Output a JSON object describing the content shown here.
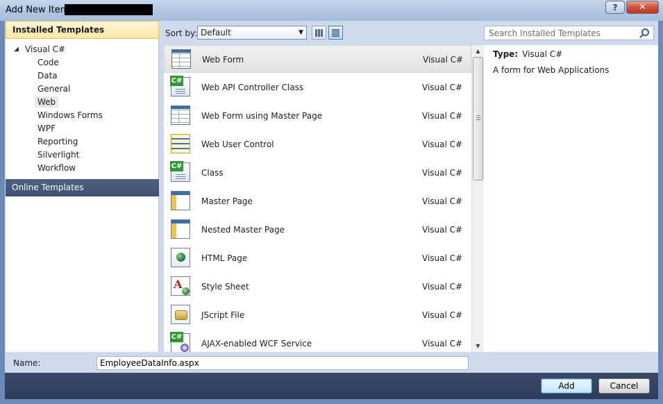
{
  "window": {
    "title": "Add New Item - ",
    "help_label": "?",
    "close_label": "✕"
  },
  "left": {
    "installed_header": "Installed Templates",
    "root": "Visual C#",
    "items": [
      "Code",
      "Data",
      "General",
      "Web",
      "Windows Forms",
      "WPF",
      "Reporting",
      "Silverlight",
      "Workflow"
    ],
    "selected": "Web",
    "online_header": "Online Templates"
  },
  "toolbar": {
    "sort_label": "Sort by:",
    "sort_value": "Default"
  },
  "search": {
    "placeholder": "Search Installed Templates"
  },
  "templates": [
    {
      "name": "Web Form",
      "lang": "Visual C#",
      "icon": "web-form-icon"
    },
    {
      "name": "Web API Controller Class",
      "lang": "Visual C#",
      "icon": "csharp-class-icon"
    },
    {
      "name": "Web Form using Master Page",
      "lang": "Visual C#",
      "icon": "web-form-icon"
    },
    {
      "name": "Web User Control",
      "lang": "Visual C#",
      "icon": "user-control-icon"
    },
    {
      "name": "Class",
      "lang": "Visual C#",
      "icon": "csharp-class-icon"
    },
    {
      "name": "Master Page",
      "lang": "Visual C#",
      "icon": "master-page-icon"
    },
    {
      "name": "Nested Master Page",
      "lang": "Visual C#",
      "icon": "master-page-icon"
    },
    {
      "name": "HTML Page",
      "lang": "Visual C#",
      "icon": "html-page-icon"
    },
    {
      "name": "Style Sheet",
      "lang": "Visual C#",
      "icon": "style-sheet-icon"
    },
    {
      "name": "JScript File",
      "lang": "Visual C#",
      "icon": "jscript-file-icon"
    },
    {
      "name": "AJAX-enabled WCF Service",
      "lang": "Visual C#",
      "icon": "wcf-service-icon"
    }
  ],
  "detail": {
    "type_label": "Type:",
    "type_value": "Visual C#",
    "description": "A form for Web Applications"
  },
  "name_field": {
    "label": "Name:",
    "value": "EmployeeDataInfo.aspx"
  },
  "buttons": {
    "add": "Add",
    "cancel": "Cancel"
  }
}
